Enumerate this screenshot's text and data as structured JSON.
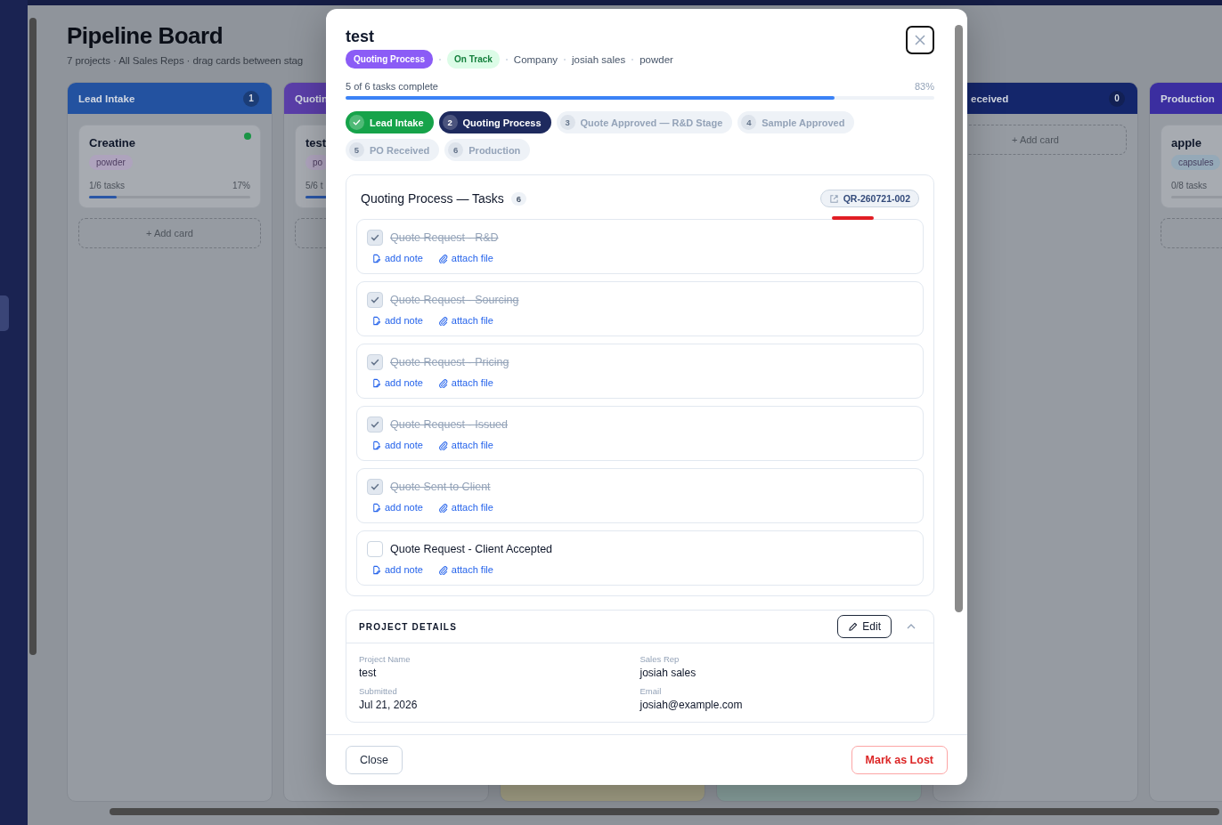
{
  "page": {
    "title": "Pipeline Board",
    "subtitle": "7 projects · All Sales Reps · drag cards between stag"
  },
  "columns": [
    {
      "label": "Lead Intake",
      "count": "1",
      "color": "#2352a0",
      "add_card": true,
      "add_label": "+ Add card",
      "cards": [
        {
          "title": "Creatine",
          "tag": {
            "label": "powder",
            "color": "#aea3bd"
          },
          "status": {
            "color": "#1a9445"
          },
          "tasks": "1/6 tasks",
          "percent": "17%",
          "level": 0.17
        }
      ]
    },
    {
      "label": "Quotin",
      "color": "#5a3ea8",
      "add_card": true,
      "cards": [
        {
          "title": "test",
          "tag": {
            "label": "po",
            "color": "#aea3bd"
          },
          "tasks": "5/6 t",
          "level": 0.83
        }
      ]
    },
    {},
    {},
    {
      "label": "eceived",
      "count": "0",
      "color": "#14266b",
      "add_card": true,
      "add_label": "+ Add card"
    },
    {
      "label": "Production",
      "color": "#3b2ea0",
      "add_card": true,
      "cards": [
        {
          "title": "apple",
          "tag": {
            "label": "capsules",
            "color": "#95a9b8"
          },
          "tasks": "0/8 tasks",
          "level": 0
        }
      ]
    }
  ],
  "modal": {
    "title": "test",
    "stage_badge": "Quoting Process",
    "status_badge": "On Track",
    "meta": [
      "Company",
      "josiah sales",
      "powder"
    ],
    "progress": {
      "label": "5 of 6 tasks complete",
      "percent": "83%",
      "level": 0.83
    },
    "stages": [
      {
        "label": "Lead Intake",
        "kind": "done"
      },
      {
        "number": "2",
        "label": "Quoting Process",
        "kind": "current"
      },
      {
        "number": "3",
        "label": "Quote Approved — R&D Stage",
        "kind": "pending"
      },
      {
        "number": "4",
        "label": "Sample Approved",
        "kind": "pending"
      },
      {
        "number": "5",
        "label": "PO Received",
        "kind": "pending"
      },
      {
        "number": "6",
        "label": "Production",
        "kind": "pending"
      }
    ],
    "tasks_panel": {
      "title": "Quoting Process — Tasks",
      "count": "6",
      "reference": "QR-260721-002",
      "tasks": [
        {
          "label": "Quote Request - R&D",
          "checked": true,
          "actions": [
            {
              "kind": "note",
              "label": "add note"
            },
            {
              "kind": "attach",
              "label": "attach file"
            }
          ]
        },
        {
          "label": "Quote Request - Sourcing",
          "checked": true,
          "actions": [
            {
              "kind": "note",
              "label": "add note"
            },
            {
              "kind": "attach",
              "label": "attach file"
            }
          ]
        },
        {
          "label": "Quote Request - Pricing",
          "checked": true,
          "actions": [
            {
              "kind": "note",
              "label": "add note"
            },
            {
              "kind": "attach",
              "label": "attach file"
            }
          ]
        },
        {
          "label": "Quote Request - Issued",
          "checked": true,
          "actions": [
            {
              "kind": "note",
              "label": "add note"
            },
            {
              "kind": "attach",
              "label": "attach file"
            }
          ]
        },
        {
          "label": "Quote Sent to Client",
          "checked": true,
          "actions": [
            {
              "kind": "note",
              "label": "add note"
            },
            {
              "kind": "attach",
              "label": "attach file"
            }
          ]
        },
        {
          "label": "Quote Request - Client Accepted",
          "checked": false,
          "actions": [
            {
              "kind": "note",
              "label": "add note"
            },
            {
              "kind": "attach",
              "label": "attach file"
            }
          ]
        }
      ]
    },
    "details": {
      "title": "PROJECT DETAILS",
      "edit_label": "Edit",
      "expanded": true,
      "fields": [
        {
          "label": "Project Name",
          "value": "test"
        },
        {
          "label": "Sales Rep",
          "value": "josiah sales"
        },
        {
          "label": "Submitted",
          "value": "Jul 21, 2026"
        },
        {
          "label": "Email",
          "value": "josiah@example.com"
        }
      ]
    },
    "footer": {
      "close": "Close",
      "mark_lost": "Mark as Lost"
    }
  }
}
